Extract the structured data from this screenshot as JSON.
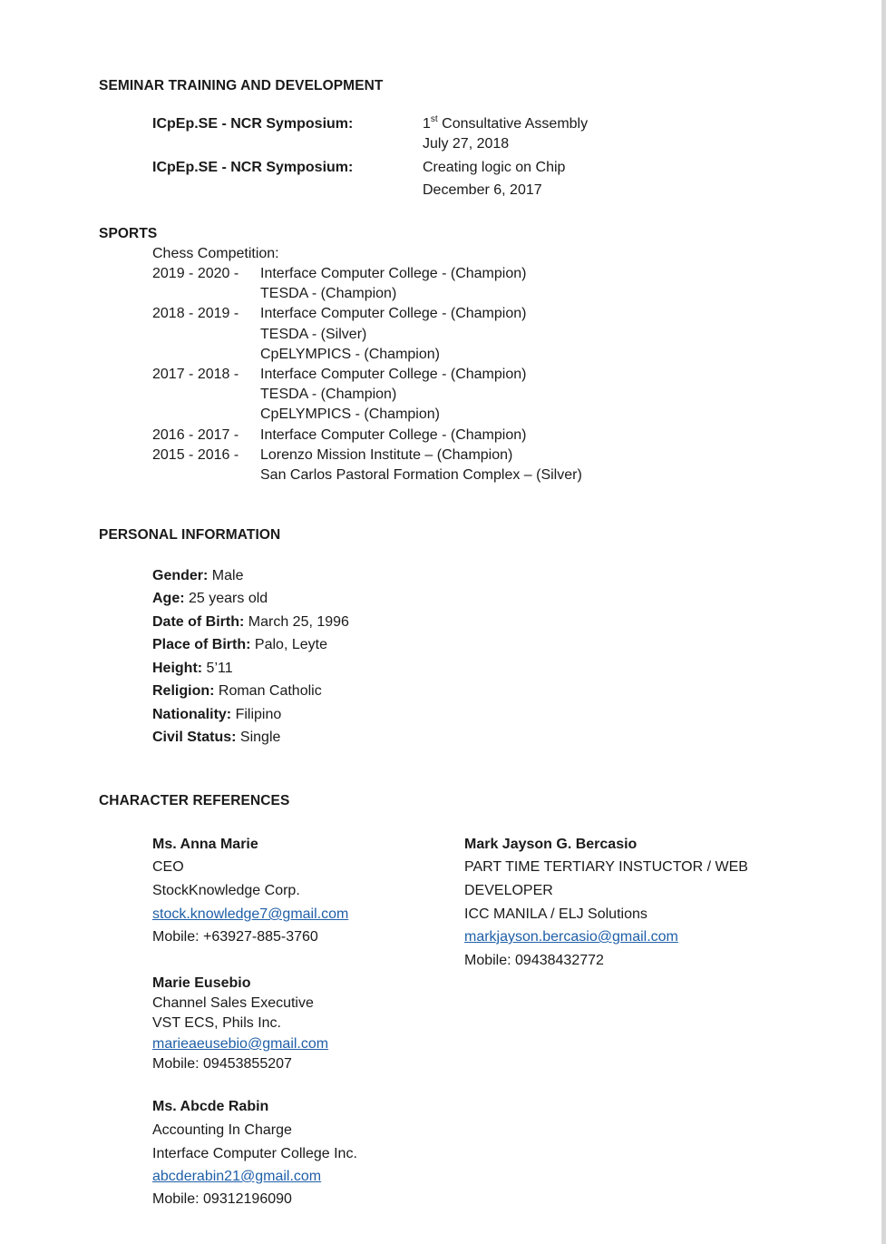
{
  "seminar": {
    "heading": "SEMINAR TRAINING AND DEVELOPMENT",
    "items": [
      {
        "label": "ICpEp.SE - NCR Symposium:",
        "ordinal_num": "1",
        "ordinal_sup": "st",
        "title": "Consultative Assembly",
        "date": "July 27, 2018"
      },
      {
        "label": "ICpEp.SE - NCR Symposium:",
        "title": "Creating logic on Chip",
        "date": "December 6, 2017"
      }
    ]
  },
  "sports": {
    "heading": "SPORTS",
    "competition": "Chess Competition:",
    "years": [
      {
        "year": "2019 - 2020 -",
        "results": [
          "Interface Computer College - (Champion)",
          "TESDA - (Champion)"
        ]
      },
      {
        "year": "2018 - 2019 -",
        "results": [
          "Interface Computer College - (Champion)",
          "TESDA - (Silver)",
          "CpELYMPICS - (Champion)"
        ]
      },
      {
        "year": "2017 - 2018 -",
        "results": [
          "Interface Computer College - (Champion)",
          "TESDA - (Champion)",
          "CpELYMPICS - (Champion)"
        ]
      },
      {
        "year": "2016 - 2017 -",
        "results": [
          "Interface Computer College - (Champion)"
        ]
      },
      {
        "year": "2015 - 2016 -",
        "results": [
          "Lorenzo Mission Institute – (Champion)",
          "San Carlos Pastoral Formation Complex – (Silver)"
        ]
      }
    ]
  },
  "personal": {
    "heading": "PERSONAL INFORMATION",
    "fields": [
      {
        "label": "Gender:",
        "value": " Male"
      },
      {
        "label": "Age:",
        "value": " 25 years old"
      },
      {
        "label": "Date of Birth:",
        "value": " March 25, 1996"
      },
      {
        "label": "Place of Birth:",
        "value": " Palo, Leyte"
      },
      {
        "label": "Height:",
        "value": " 5’11"
      },
      {
        "label": "Religion:",
        "value": " Roman Catholic"
      },
      {
        "label": "Nationality:",
        "value": " Filipino"
      },
      {
        "label": "Civil Status:",
        "value": " Single"
      }
    ]
  },
  "references": {
    "heading": "CHARACTER REFERENCES",
    "people": [
      {
        "name": "Ms. Anna Marie",
        "position": "CEO",
        "company": "StockKnowledge Corp.",
        "email": "stock.knowledge7@gmail.com",
        "mobile": "Mobile: +63927-885-3760"
      },
      {
        "name": "Mark Jayson G. Bercasio",
        "position_line1": "PART TIME TERTIARY INSTUCTOR / WEB",
        "position_line2": "DEVELOPER",
        "company": "ICC MANILA / ELJ Solutions",
        "email": "markjayson.bercasio@gmail.com",
        "mobile": "Mobile: 09438432772"
      },
      {
        "name": "Marie Eusebio",
        "position": "Channel Sales Executive",
        "company": "VST ECS, Phils Inc.",
        "email": "marieaeusebio@gmail.com",
        "mobile": "Mobile: 09453855207"
      },
      {
        "name": "Ms. Abcde Rabin",
        "position": "Accounting In Charge",
        "company": "Interface Computer College Inc.",
        "email": "abcderabin21@gmail.com",
        "mobile": "Mobile: 09312196090"
      }
    ]
  }
}
